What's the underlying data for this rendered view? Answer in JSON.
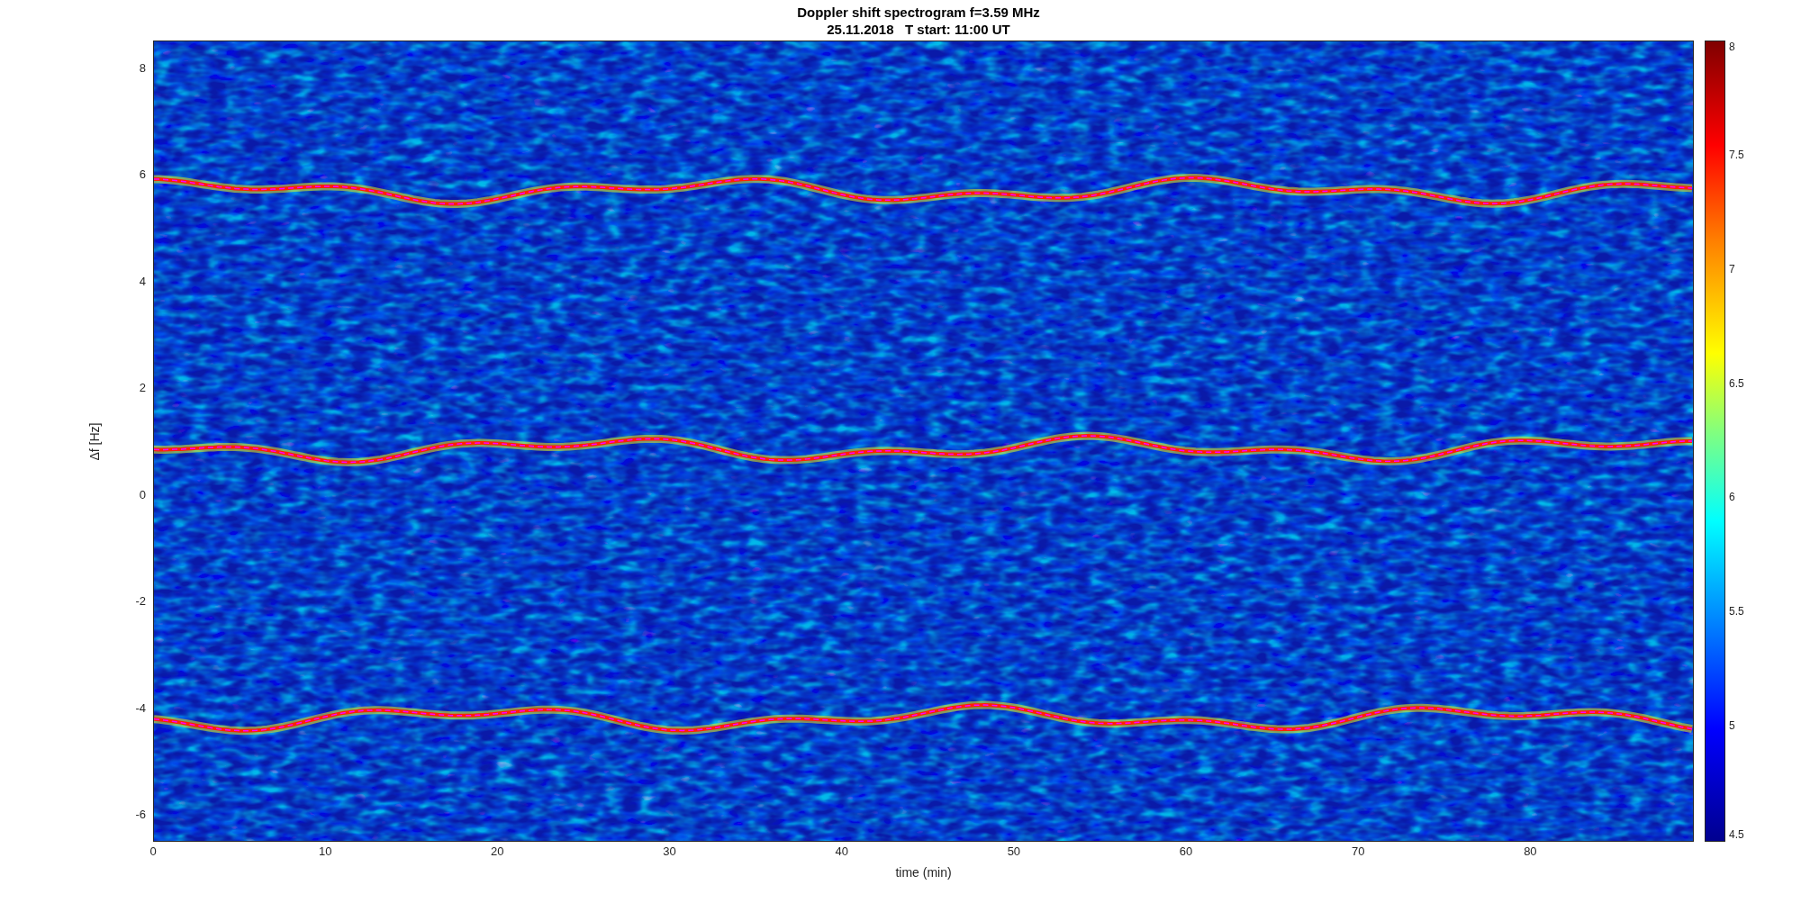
{
  "title": {
    "line_1": "Doppler shift spectrogram f=3.59 MHz",
    "line_2": "25.11.2018   T start: 11:00 UT"
  },
  "plot": {
    "xlabel": "time (min)",
    "ylabel": "Δf [Hz]",
    "xticks": [
      "0",
      "10",
      "20",
      "30",
      "40",
      "50",
      "60",
      "70",
      "80"
    ],
    "yticks": [
      "8",
      "6",
      "4",
      "2",
      "0",
      "-2",
      "-4",
      "-6"
    ]
  },
  "colorbar": {
    "ticks": [
      "8",
      "7.5",
      "7",
      "6.5",
      "6",
      "5.5",
      "5",
      "4.5"
    ]
  }
}
